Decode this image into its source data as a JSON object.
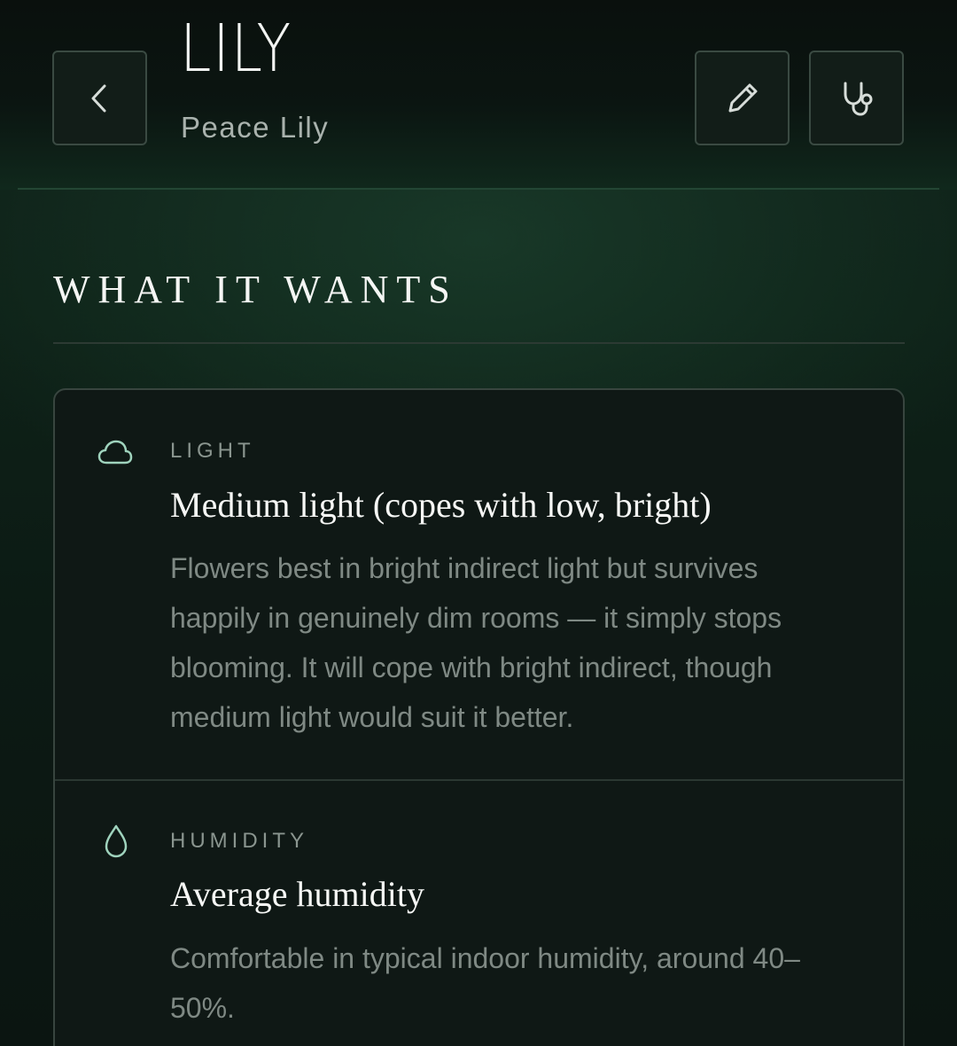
{
  "header": {
    "plant_name": "LILY",
    "species": "Peace Lily",
    "icons": {
      "back": "chevron-left-icon",
      "edit": "pencil-icon",
      "health": "stethoscope-icon"
    }
  },
  "section": {
    "title": "WHAT IT WANTS"
  },
  "requirements": [
    {
      "icon": "cloud-icon",
      "label": "LIGHT",
      "value": "Medium light (copes with low, bright)",
      "description": "Flowers best in bright indirect light but survives happily in genuinely dim rooms — it simply stops blooming. It will cope with bright indirect, though medium light would suit it better."
    },
    {
      "icon": "droplet-icon",
      "label": "HUMIDITY",
      "value": "Average humidity",
      "description": "Comfortable in typical indoor humidity, around 40–50%."
    }
  ],
  "colors": {
    "accent": "#9fd3bd",
    "background": "#0e1d16"
  }
}
